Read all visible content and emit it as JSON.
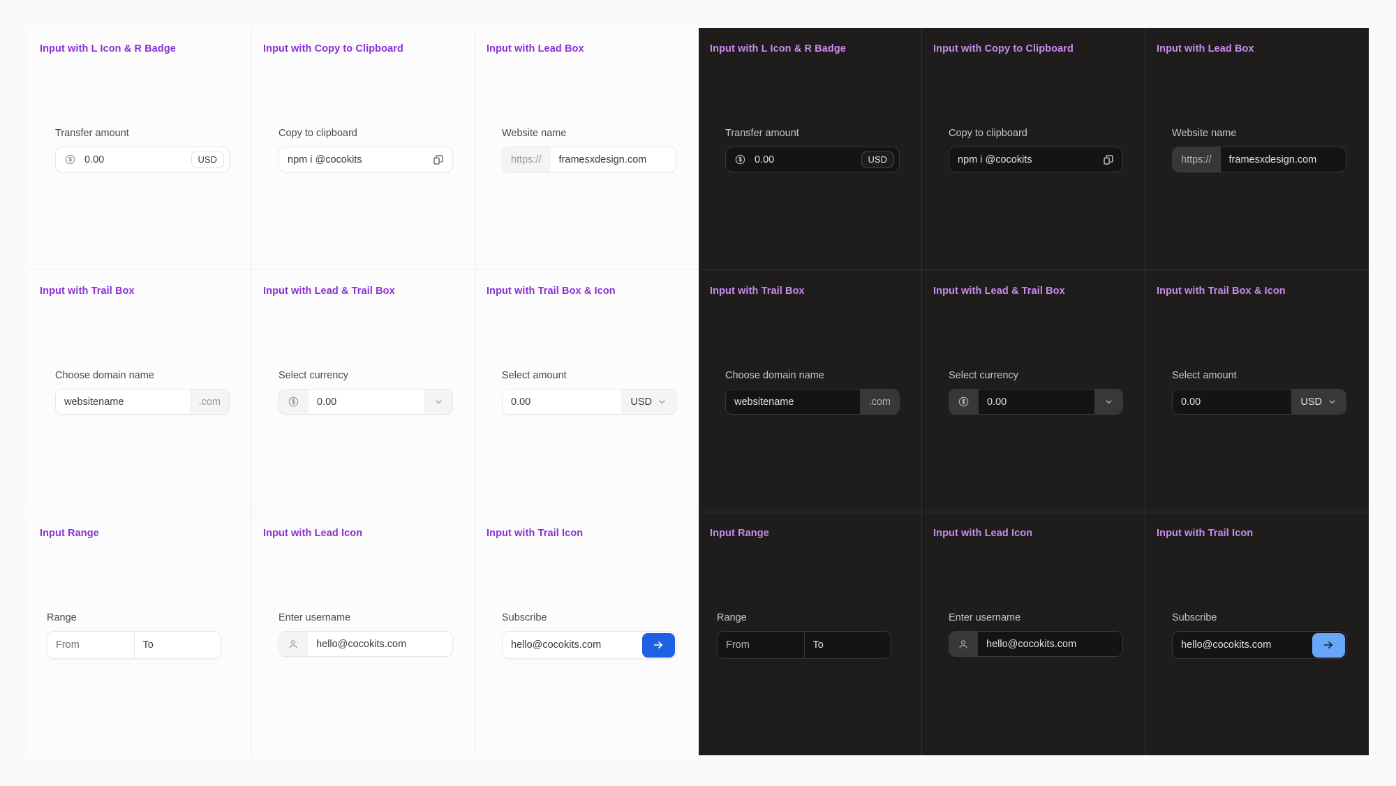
{
  "theme": {
    "light_bg": "#fcfcfc",
    "dark_bg": "#1f1c1c",
    "title_light": "#8b2fd6",
    "title_dark": "#c88cf0",
    "accent_light": "#1f61e5",
    "accent_dark": "#68a7f7"
  },
  "cells": [
    {
      "title": "Input with L Icon & R Badge",
      "label": "Transfer amount",
      "value": "0.00",
      "badge": "USD",
      "lead_icon": "dollar-circle-icon"
    },
    {
      "title": "Input with Copy to Clipboard",
      "label": "Copy to clipboard",
      "value": "npm i @cocokits",
      "trail_icon": "copy-icon"
    },
    {
      "title": "Input with Lead Box",
      "label": "Website name",
      "lead_box": "https://",
      "value": "framesxdesign.com"
    },
    {
      "title": "Input with Trail Box",
      "label": "Choose domain name",
      "value": "websitename",
      "trail_box": ".com"
    },
    {
      "title": "Input with Lead & Trail Box",
      "label": "Select currency",
      "lead_icon": "dollar-circle-icon",
      "value": "0.00",
      "trail_icon": "chevron-down-icon"
    },
    {
      "title": "Input with Trail Box & Icon",
      "label": "Select amount",
      "value": "0.00",
      "trail_box": "USD",
      "trail_icon": "chevron-down-icon"
    },
    {
      "title": "Input Range",
      "label": "Range",
      "from_placeholder": "From",
      "to_placeholder": "To"
    },
    {
      "title": "Input with Lead Icon",
      "label": "Enter username",
      "lead_icon": "user-icon",
      "value": "hello@cocokits.com"
    },
    {
      "title": "Input with Trail Icon",
      "label": "Subscribe",
      "value": "hello@cocokits.com",
      "submit_icon": "arrow-right-icon"
    }
  ]
}
